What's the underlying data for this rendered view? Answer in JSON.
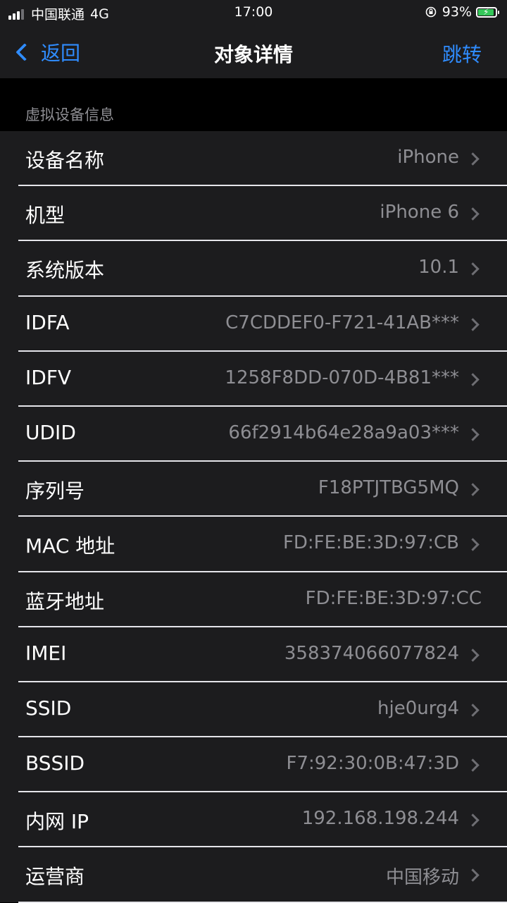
{
  "status_bar": {
    "carrier": "中国联通",
    "network": "4G",
    "time": "17:00",
    "battery_percent": "93%",
    "battery_level": 0.93,
    "battery_color": "#34c759"
  },
  "nav": {
    "back_label": "返回",
    "title": "对象详情",
    "action_label": "跳转",
    "accent_color": "#2f8cff"
  },
  "section": {
    "header": "虚拟设备信息"
  },
  "rows": [
    {
      "label": "设备名称",
      "value": "iPhone",
      "chevron": true
    },
    {
      "label": "机型",
      "value": "iPhone 6",
      "chevron": true
    },
    {
      "label": "系统版本",
      "value": "10.1",
      "chevron": true
    },
    {
      "label": "IDFA",
      "value": "C7CDDEF0-F721-41AB***",
      "chevron": true
    },
    {
      "label": "IDFV",
      "value": "1258F8DD-070D-4B81***",
      "chevron": true
    },
    {
      "label": "UDID",
      "value": "66f2914b64e28a9a03***",
      "chevron": true
    },
    {
      "label": "序列号",
      "value": "F18PTJTBG5MQ",
      "chevron": true
    },
    {
      "label": "MAC 地址",
      "value": "FD:FE:BE:3D:97:CB",
      "chevron": true
    },
    {
      "label": "蓝牙地址",
      "value": "FD:FE:BE:3D:97:CC",
      "chevron": false
    },
    {
      "label": "IMEI",
      "value": "358374066077824",
      "chevron": true
    },
    {
      "label": "SSID",
      "value": "hje0urg4",
      "chevron": true
    },
    {
      "label": "BSSID",
      "value": "F7:92:30:0B:47:3D",
      "chevron": true
    },
    {
      "label": "内网 IP",
      "value": "192.168.198.244",
      "chevron": true
    },
    {
      "label": "运营商",
      "value": "中国移动",
      "chevron": true
    }
  ]
}
